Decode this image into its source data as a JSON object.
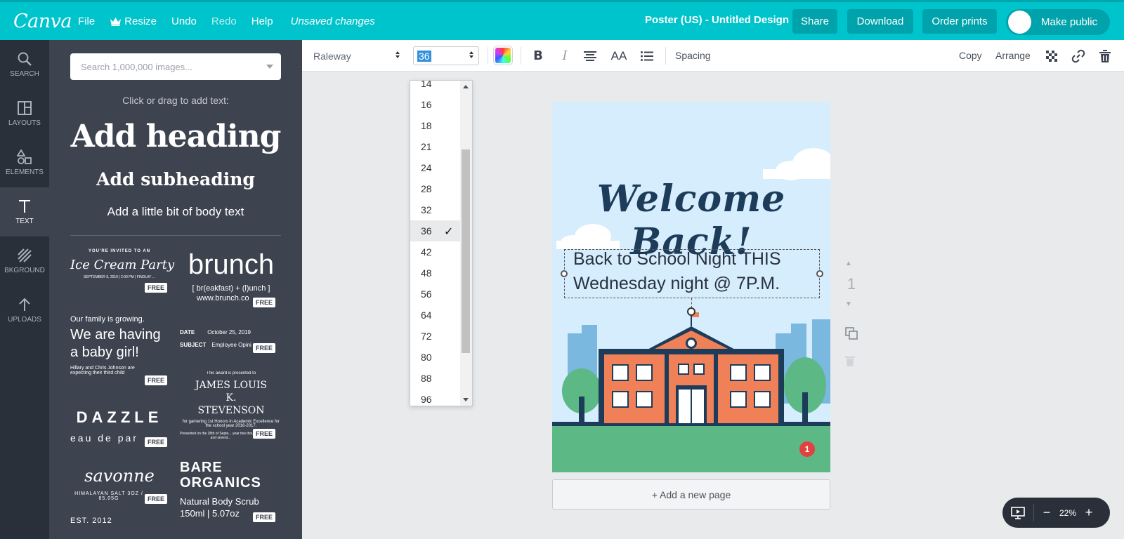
{
  "topbar": {
    "logo": "Canva",
    "menu": {
      "file": "File",
      "resize": "Resize",
      "undo": "Undo",
      "redo": "Redo",
      "help": "Help"
    },
    "unsaved": "Unsaved changes",
    "doc_title": "Poster (US) - Untitled Design",
    "share": "Share",
    "download": "Download",
    "order_prints": "Order prints",
    "make_public": "Make public"
  },
  "rail": {
    "search": "SEARCH",
    "layouts": "LAYOUTS",
    "elements": "ELEMENTS",
    "text": "TEXT",
    "background": "BKGROUND",
    "uploads": "UPLOADS"
  },
  "panel": {
    "search_placeholder": "Search 1,000,000 images...",
    "hint": "Click or drag to add text:",
    "add_heading": "Add heading",
    "add_subheading": "Add subheading",
    "add_body": "Add a little bit of body text",
    "free_label": "FREE",
    "templates": {
      "ice_invite": "YOU'RE INVITED TO AN",
      "ice_title": "Ice Cream Party",
      "ice_date": "SEPTEMBER 9, 2019 | 2:00 PM | FINDLAY ...",
      "brunch_title": "brunch",
      "brunch_sub": "[ br(eakfast) + (l)unch ]",
      "brunch_url": "www.brunch.co",
      "baby_top": "Our family is growing.",
      "baby_main": "We are having a baby girl!",
      "baby_sub": "Hillary and Chris Johnson are expecting their third child",
      "memo_date_label": "DATE",
      "memo_date": "October 25, 2019",
      "memo_subject_label": "SUBJECT",
      "memo_subject": "Employee Opini",
      "award_top": "This award is presented to",
      "award_name": "JAMES LOUIS K. STEVENSON",
      "award_reason": "for garnering 1st Honors in Academic Excellence for the school year 2016-2017.",
      "award_date": "Presented on the 28th of Septe... year two thousand and sevent...",
      "dazzle_title": "DAZZLE",
      "dazzle_sub": "eau de par",
      "savonne_title": "savonne",
      "savonne_sub": "HIMALAYAN SALT 3OZ / 85.05G",
      "savonne_est": "EST. 2012",
      "bare_title": "BARE ORGANICS",
      "bare_sub": "Natural Body Scrub",
      "bare_size": "150ml | 5.07oz"
    }
  },
  "format_bar": {
    "font": "Raleway",
    "size": "36",
    "bold": "B",
    "italic": "I",
    "case": "AA",
    "spacing": "Spacing",
    "copy": "Copy",
    "arrange": "Arrange"
  },
  "size_options": [
    "14",
    "16",
    "18",
    "21",
    "24",
    "28",
    "32",
    "36",
    "42",
    "48",
    "56",
    "64",
    "72",
    "80",
    "88",
    "96"
  ],
  "selected_size": "36",
  "poster": {
    "title": "Welcome Back!",
    "body": "Back to School Night THIS Wednesday night @  7P.M.",
    "page_badge": "1"
  },
  "page_number": "1",
  "add_page": "+ Add a new page",
  "zoom": {
    "level": "22%",
    "minus": "−",
    "plus": "+"
  },
  "colors": {
    "topbar": "#00c4cc",
    "rail": "#293039",
    "panel": "#3d434f",
    "poster_sky": "#d5edfd",
    "poster_grass": "#5cb884",
    "school": "#f08057",
    "school_trim": "#1d3c5a"
  }
}
